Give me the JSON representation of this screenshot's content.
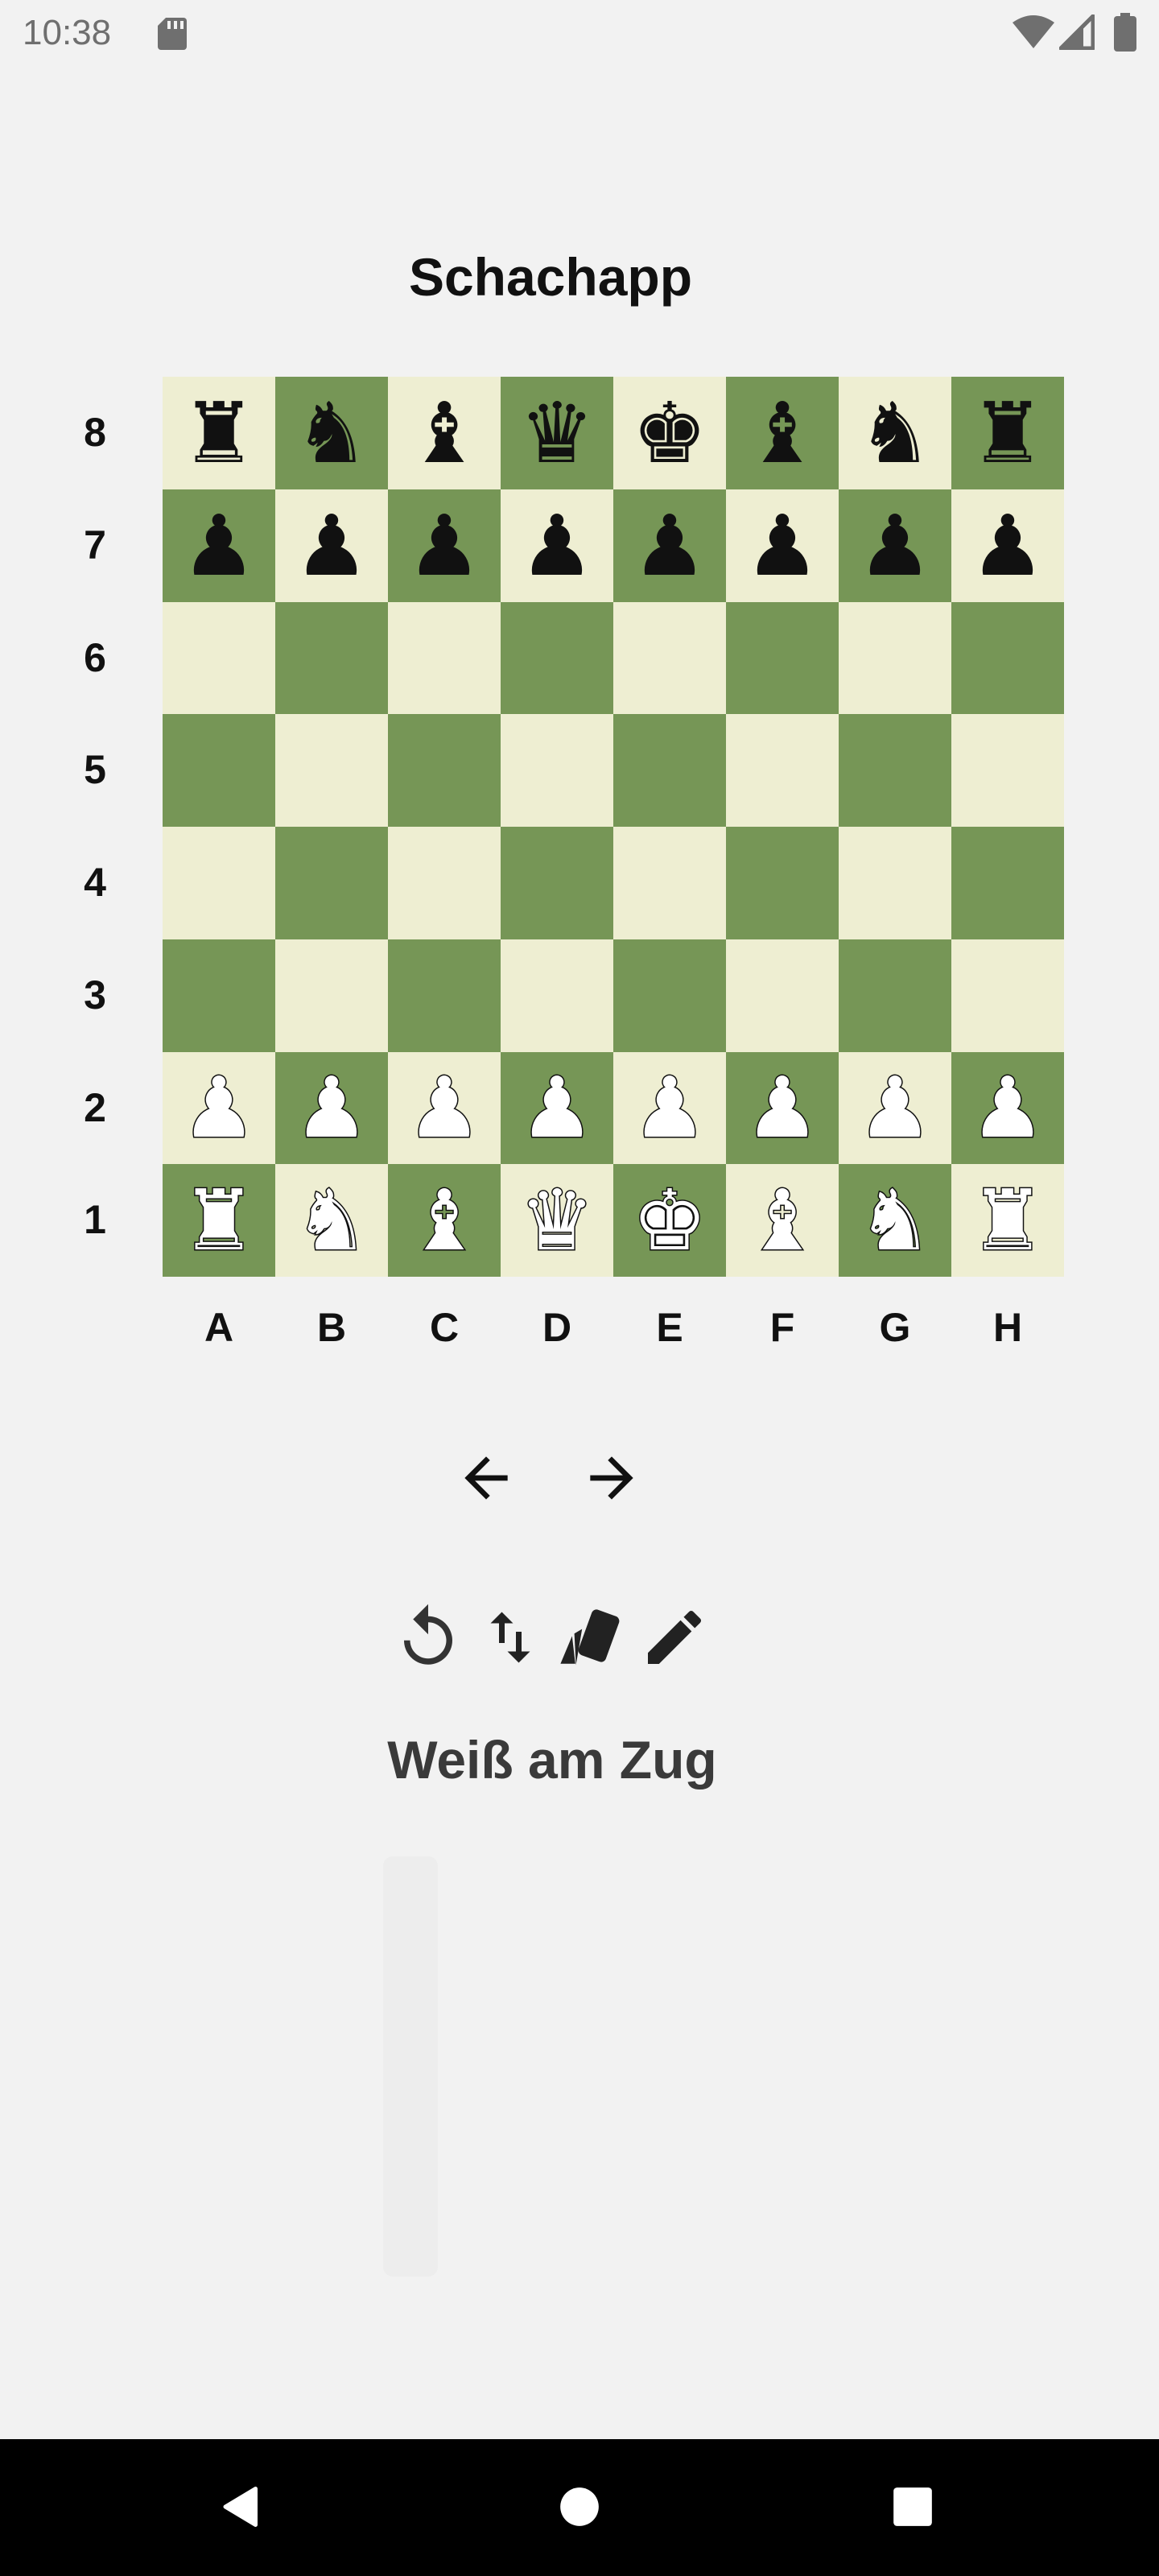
{
  "status_bar": {
    "time": "10:38",
    "icons": [
      "sd-card-icon",
      "wifi-icon",
      "signal-icon",
      "battery-icon"
    ]
  },
  "app": {
    "title": "Schachapp"
  },
  "board": {
    "ranks": [
      "8",
      "7",
      "6",
      "5",
      "4",
      "3",
      "2",
      "1"
    ],
    "files": [
      "A",
      "B",
      "C",
      "D",
      "E",
      "F",
      "G",
      "H"
    ],
    "light_color": "#eeeed2",
    "dark_color": "#769656",
    "position": [
      [
        "♜",
        "♞",
        "♝",
        "♛",
        "♚",
        "♝",
        "♞",
        "♜"
      ],
      [
        "♟",
        "♟",
        "♟",
        "♟",
        "♟",
        "♟",
        "♟",
        "♟"
      ],
      [
        "",
        "",
        "",
        "",
        "",
        "",
        "",
        ""
      ],
      [
        "",
        "",
        "",
        "",
        "",
        "",
        "",
        ""
      ],
      [
        "",
        "",
        "",
        "",
        "",
        "",
        "",
        ""
      ],
      [
        "",
        "",
        "",
        "",
        "",
        "",
        "",
        ""
      ],
      [
        "♟",
        "♟",
        "♟",
        "♟",
        "♟",
        "♟",
        "♟",
        "♟"
      ],
      [
        "♜",
        "♞",
        "♝",
        "♛",
        "♚",
        "♝",
        "♞",
        "♜"
      ]
    ],
    "piece_colors": [
      [
        "black",
        "black",
        "black",
        "black",
        "black",
        "black",
        "black",
        "black"
      ],
      [
        "black",
        "black",
        "black",
        "black",
        "black",
        "black",
        "black",
        "black"
      ],
      [
        "",
        "",
        "",
        "",
        "",
        "",
        "",
        ""
      ],
      [
        "",
        "",
        "",
        "",
        "",
        "",
        "",
        ""
      ],
      [
        "",
        "",
        "",
        "",
        "",
        "",
        "",
        ""
      ],
      [
        "",
        "",
        "",
        "",
        "",
        "",
        "",
        ""
      ],
      [
        "white",
        "white",
        "white",
        "white",
        "white",
        "white",
        "white",
        "white"
      ],
      [
        "white",
        "white",
        "white",
        "white",
        "white",
        "white",
        "white",
        "white"
      ]
    ],
    "piece_names": {
      "♜": "rook",
      "♞": "knight",
      "♝": "bishop",
      "♛": "queen",
      "♚": "king",
      "♟": "pawn"
    }
  },
  "navigation": {
    "icons": [
      "arrow-left-icon",
      "arrow-right-icon"
    ]
  },
  "toolbar": {
    "icons": [
      "reset-icon",
      "swap-vertical-icon",
      "cards-icon",
      "pencil-icon"
    ]
  },
  "status": {
    "turn": "Weiß am Zug"
  },
  "colors": {
    "background": "#f2f2f2",
    "text": "#111111",
    "status_text": "#3a3a3a"
  }
}
